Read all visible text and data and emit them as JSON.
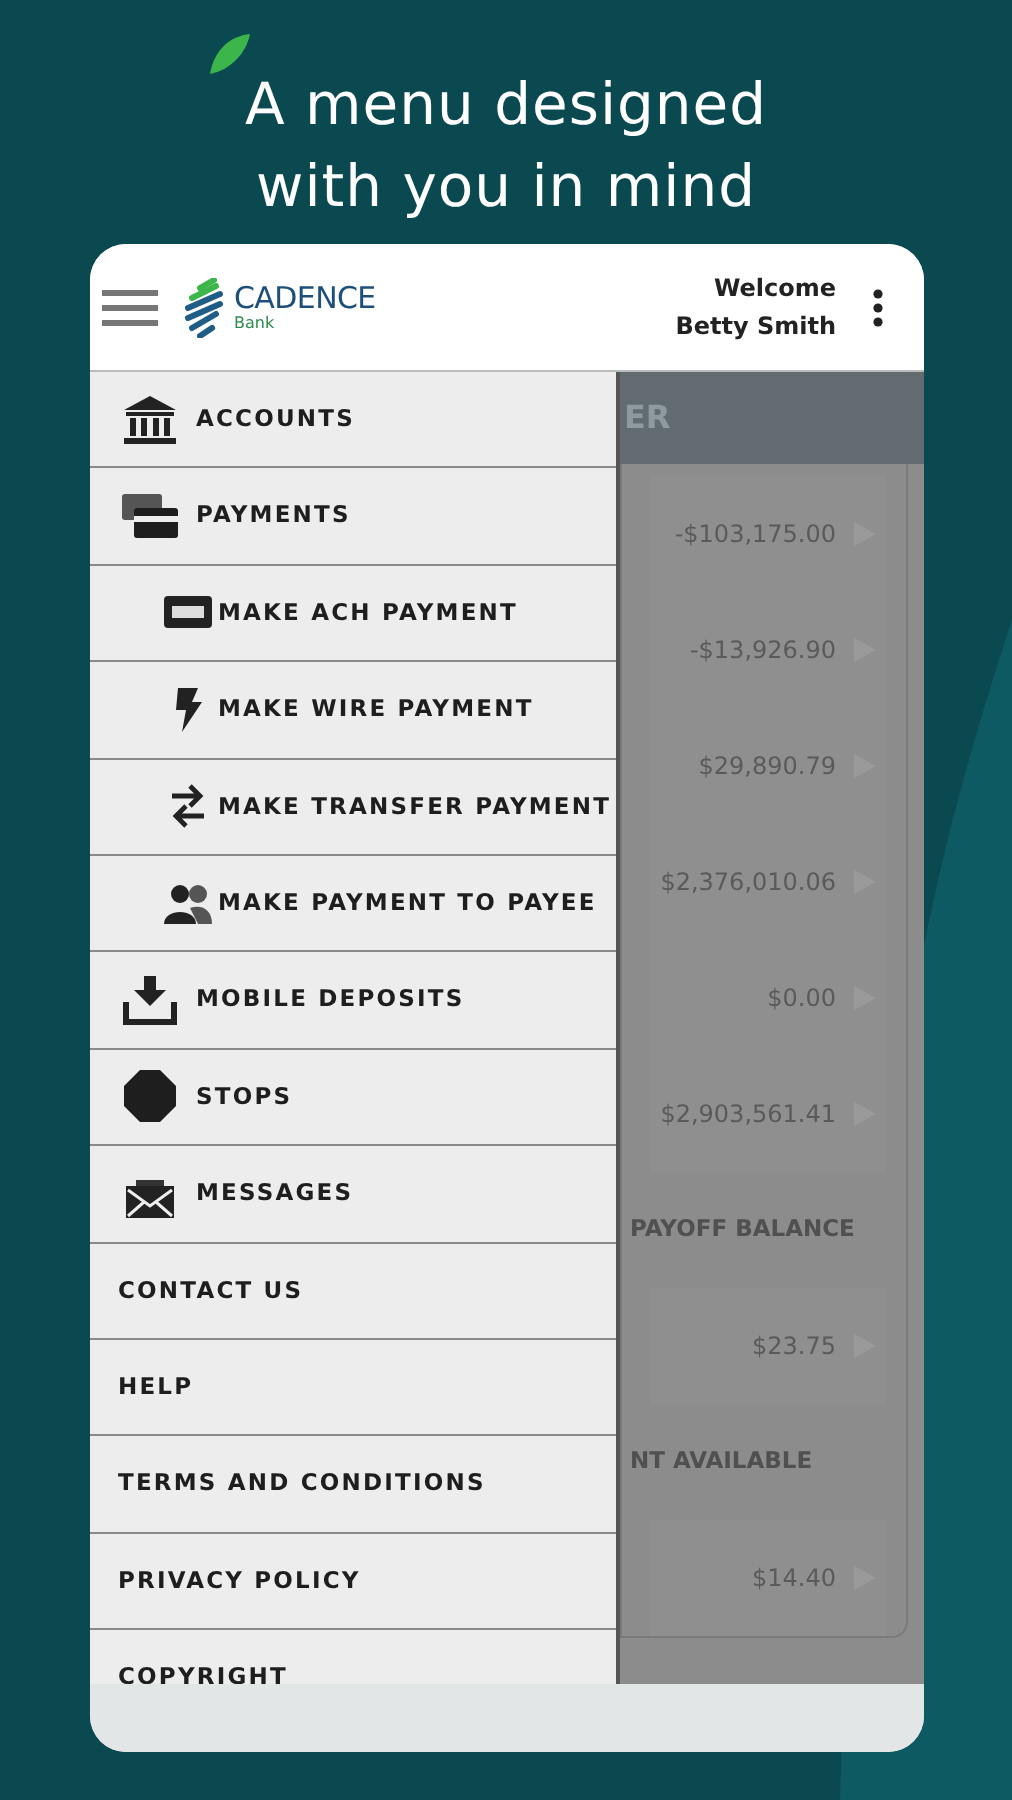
{
  "headline": [
    "A menu designed",
    "with you in mind"
  ],
  "header": {
    "brand": "CADENCE",
    "brand_sub": "Bank",
    "welcome": "Welcome",
    "user": "Betty Smith"
  },
  "menu": [
    {
      "label": "ACCOUNTS",
      "kind": "icon"
    },
    {
      "label": "PAYMENTS",
      "kind": "icon",
      "children": [
        {
          "label": "MAKE ACH PAYMENT",
          "kind": "icon"
        },
        {
          "label": "MAKE WIRE PAYMENT",
          "kind": "icon"
        },
        {
          "label": "MAKE TRANSFER PAYMENT",
          "kind": "icon"
        },
        {
          "label": "MAKE PAYMENT TO PAYEE",
          "kind": "icon"
        }
      ]
    },
    {
      "label": "MOBILE DEPOSITS",
      "kind": "icon"
    },
    {
      "label": "STOPS",
      "kind": "icon"
    },
    {
      "label": "MESSAGES",
      "kind": "icon"
    },
    {
      "label": "CONTACT US",
      "kind": "plain"
    },
    {
      "label": "HELP",
      "kind": "plain"
    },
    {
      "label": "TERMS AND CONDITIONS",
      "kind": "plain"
    },
    {
      "label": "PRIVACY POLICY",
      "kind": "plain"
    },
    {
      "label": "COPYRIGHT",
      "kind": "plain"
    }
  ],
  "behind": {
    "title": "ER",
    "rows": [
      {
        "kind": "amount",
        "text": "-$103,175.00"
      },
      {
        "kind": "amount",
        "text": "-$13,926.90"
      },
      {
        "kind": "amount",
        "text": "$29,890.79"
      },
      {
        "kind": "amount",
        "text": "$2,376,010.06"
      },
      {
        "kind": "amount",
        "text": "$0.00"
      },
      {
        "kind": "amount",
        "text": "$2,903,561.41"
      },
      {
        "kind": "label",
        "text": "PAYOFF BALANCE"
      },
      {
        "kind": "amount",
        "text": "$23.75"
      },
      {
        "kind": "label",
        "text": "NT AVAILABLE"
      },
      {
        "kind": "amount",
        "text": "$14.40"
      }
    ]
  }
}
